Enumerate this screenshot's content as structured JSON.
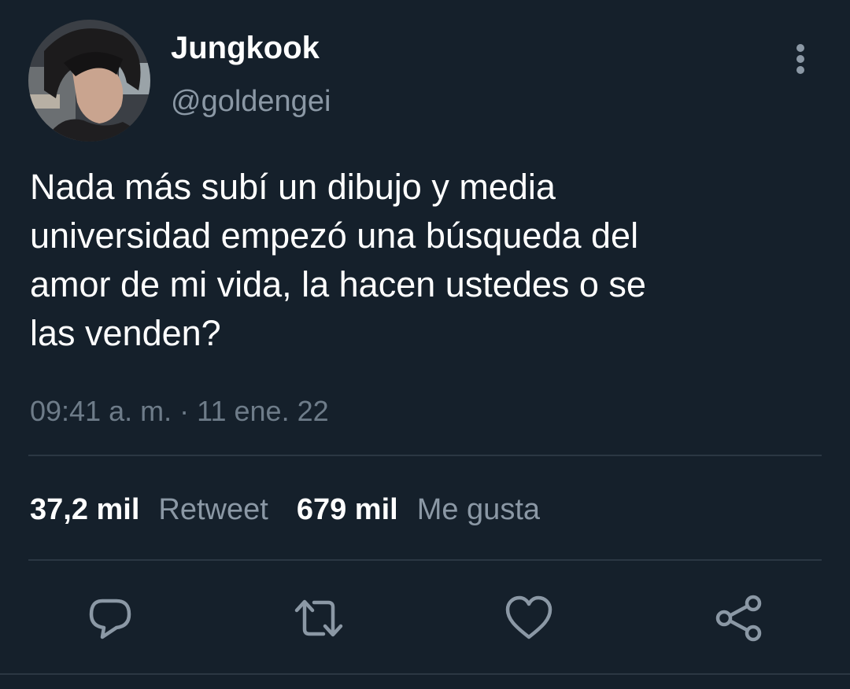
{
  "tweet": {
    "author": {
      "display_name": "Jungkook",
      "handle": "@goldengei"
    },
    "text_lines": [
      "Nada más subí un dibujo y media",
      "universidad empezó una búsqueda del",
      "amor de mi vida, la hacen ustedes o se",
      "las venden?"
    ],
    "meta": {
      "time": "09:41 a. m.",
      "separator": "·",
      "date": "11 ene. 22"
    },
    "stats": {
      "retweets_count": "37,2 mil",
      "retweets_label": "Retweet",
      "likes_count": "679 mil",
      "likes_label": "Me gusta"
    },
    "actions": [
      {
        "icon": "reply-icon"
      },
      {
        "icon": "retweet-icon"
      },
      {
        "icon": "like-icon"
      },
      {
        "icon": "share-icon"
      }
    ],
    "more_icon": "more-vertical-icon"
  },
  "colors": {
    "background": "#15202b",
    "primary_text": "#ffffff",
    "secondary_text": "#8b98a5",
    "divider": "#2b3743",
    "icon": "#8b98a5"
  }
}
